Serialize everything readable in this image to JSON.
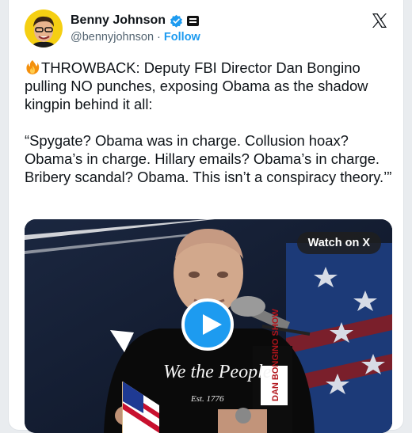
{
  "author": {
    "name": "Benny Johnson",
    "handle": "@bennyjohnson",
    "separator": " · ",
    "follow_label": "Follow",
    "verified_icon": "verified-badge-icon",
    "affiliation_icon": "affiliation-badge-icon",
    "verified_color": "#1d9bf0"
  },
  "platform_icon": "x-logo-icon",
  "tweet": {
    "emoji_icon": "fire-emoji-icon",
    "paragraph1": "THROWBACK: Deputy FBI Director Dan Bongino pulling NO punches, exposing Obama as the shadow kingpin behind it all:",
    "paragraph2": "“Spygate? Obama was in charge. Collusion hoax? Obama’s in charge. Hillary emails? Obama’s in charge. Bribery scandal? Obama. This isn’t a conspiracy theory.’”"
  },
  "video": {
    "watch_label": "Watch on X",
    "play_icon": "play-icon",
    "shirt_text": "We the People",
    "shirt_subtext": "Est. 1776",
    "mic_sign_text": "DAN BONGINO SHOW"
  }
}
